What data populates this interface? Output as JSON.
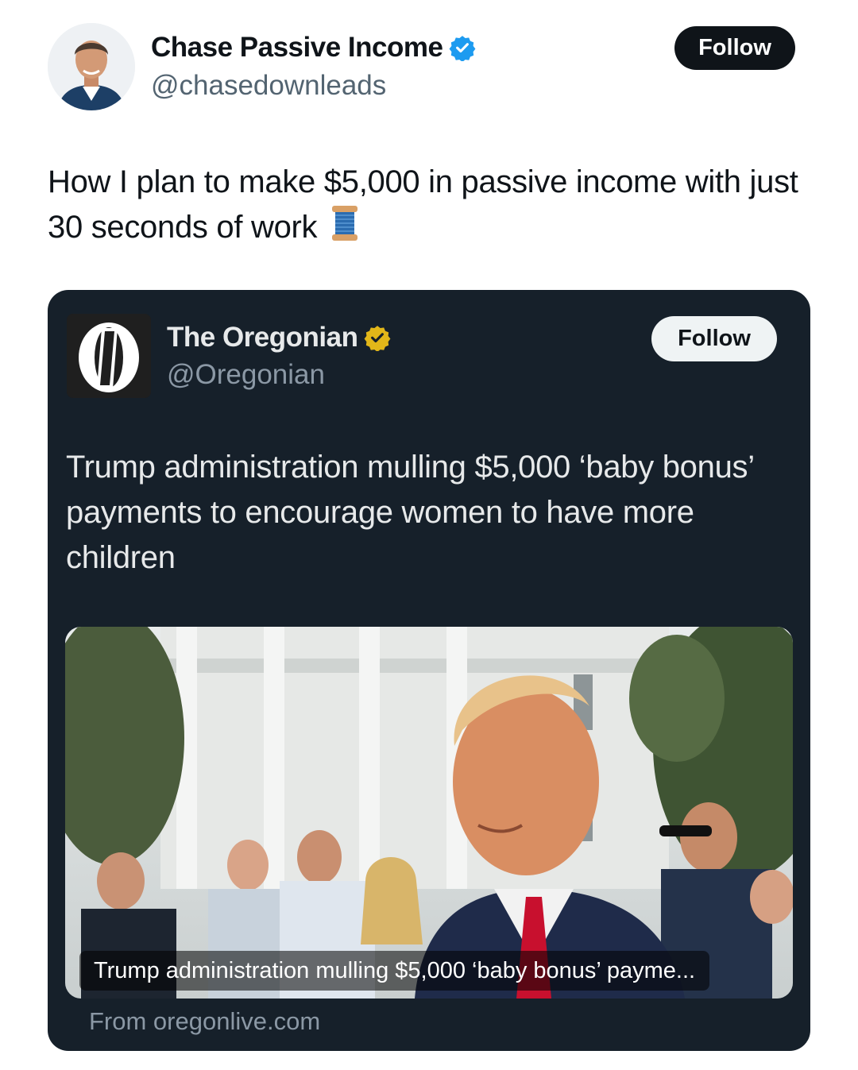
{
  "author": {
    "name": "Chase Passive Income",
    "handle": "@chasedownleads",
    "verified": true,
    "badge_color": "#1d9bf0",
    "avatar_icon": "person-avatar"
  },
  "follow_button": {
    "label": "Follow"
  },
  "tweet": {
    "text": "How I plan to make $5,000 in passive income with just 30 seconds of work",
    "emoji_icon": "spool-of-thread-icon"
  },
  "quoted": {
    "name": "The Oregonian",
    "handle": "@Oregonian",
    "verified": true,
    "badge_color": "#e2b719",
    "logo_icon": "oregonian-o-logo",
    "follow_label": "Follow",
    "text": "Trump administration mulling $5,000 ‘baby bonus’ payments to encourage women to have more children",
    "card": {
      "caption": "Trump administration mulling $5,000 ‘baby bonus’ payme...",
      "source": "From oregonlive.com",
      "image_icon": "article-photo"
    }
  },
  "colors": {
    "background": "#ffffff",
    "quote_background": "#16202a",
    "text_primary": "#0f1419",
    "text_secondary": "#536471"
  }
}
